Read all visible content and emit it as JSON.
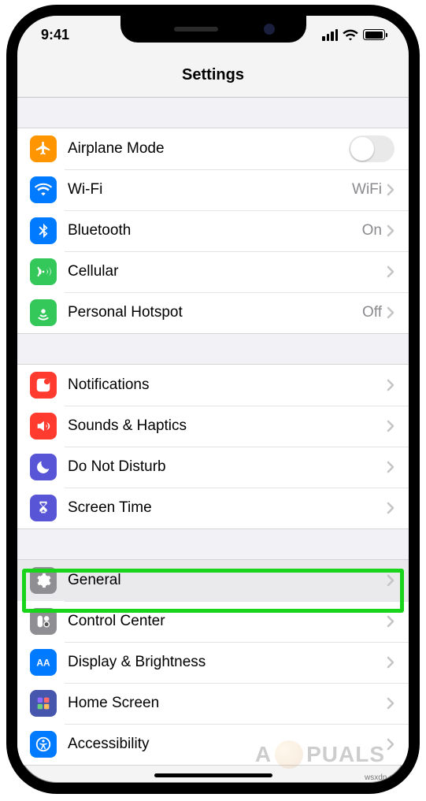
{
  "status": {
    "time": "9:41"
  },
  "header": {
    "title": "Settings"
  },
  "groups": [
    {
      "rows": [
        {
          "id": "airplane",
          "icon": "airplane-icon",
          "color": "#ff9500",
          "label": "Airplane Mode",
          "accessory": "toggle",
          "toggle": false
        },
        {
          "id": "wifi",
          "icon": "wifi-icon",
          "color": "#007aff",
          "label": "Wi-Fi",
          "value": "WiFi",
          "accessory": "chevron"
        },
        {
          "id": "bluetooth",
          "icon": "bluetooth-icon",
          "color": "#007aff",
          "label": "Bluetooth",
          "value": "On",
          "accessory": "chevron"
        },
        {
          "id": "cellular",
          "icon": "cellular-icon",
          "color": "#34c759",
          "label": "Cellular",
          "accessory": "chevron"
        },
        {
          "id": "hotspot",
          "icon": "hotspot-icon",
          "color": "#34c759",
          "label": "Personal Hotspot",
          "value": "Off",
          "accessory": "chevron"
        }
      ]
    },
    {
      "rows": [
        {
          "id": "notifications",
          "icon": "notifications-icon",
          "color": "#ff3b30",
          "label": "Notifications",
          "accessory": "chevron"
        },
        {
          "id": "sounds",
          "icon": "sounds-icon",
          "color": "#ff3b30",
          "label": "Sounds & Haptics",
          "accessory": "chevron"
        },
        {
          "id": "dnd",
          "icon": "moon-icon",
          "color": "#5856d6",
          "label": "Do Not Disturb",
          "accessory": "chevron"
        },
        {
          "id": "screentime",
          "icon": "hourglass-icon",
          "color": "#5856d6",
          "label": "Screen Time",
          "accessory": "chevron"
        }
      ]
    },
    {
      "rows": [
        {
          "id": "general",
          "icon": "gear-icon",
          "color": "#8e8e93",
          "label": "General",
          "accessory": "chevron",
          "highlighted": true
        },
        {
          "id": "controlcenter",
          "icon": "control-center-icon",
          "color": "#8e8e93",
          "label": "Control Center",
          "accessory": "chevron"
        },
        {
          "id": "display",
          "icon": "display-icon",
          "color": "#007aff",
          "label": "Display & Brightness",
          "accessory": "chevron"
        },
        {
          "id": "homescreen",
          "icon": "home-screen-icon",
          "color": "#4556ac",
          "label": "Home Screen",
          "accessory": "chevron"
        },
        {
          "id": "accessibility",
          "icon": "accessibility-icon",
          "color": "#007aff",
          "label": "Accessibility",
          "accessory": "chevron"
        }
      ]
    }
  ],
  "watermark": {
    "prefix": "A",
    "suffix": "PUALS"
  },
  "source": "wsxdn.com"
}
